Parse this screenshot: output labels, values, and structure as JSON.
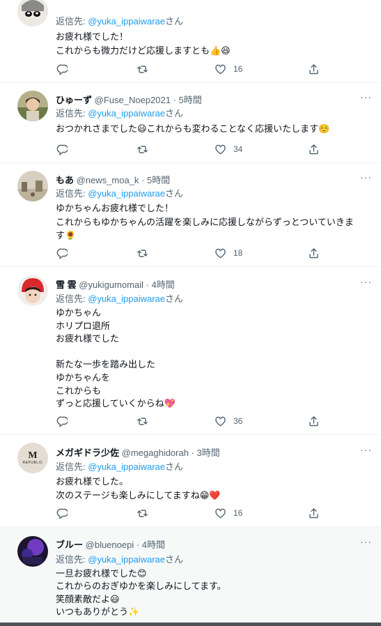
{
  "tweets": [
    {
      "name": "",
      "handle": "",
      "time": "",
      "reply_label": "返信先:",
      "reply_to": "@yuka_ippaiwarae",
      "reply_suffix": "さん",
      "text": "お疲れ様でした！\nこれからも微力だけど応援しますとも👍😆",
      "likes": "16",
      "avatar": "avatar-anime-icon",
      "highlighted": false
    },
    {
      "name": "ひゅーず",
      "handle": "@Fuse_Noep2021",
      "time": "· 5時間",
      "reply_label": "返信先:",
      "reply_to": "@yuka_ippaiwarae",
      "reply_suffix": "さん",
      "text": "おつかれさまでした😃これからも変わることなく応援いたします☺️",
      "likes": "34",
      "avatar": "avatar-photo-icon",
      "highlighted": false
    },
    {
      "name": "もあ",
      "handle": "@news_moa_k",
      "time": "· 5時間",
      "reply_label": "返信先:",
      "reply_to": "@yuka_ippaiwarae",
      "reply_suffix": "さん",
      "text": "ゆかちゃんお疲れ様でした！\nこれからもゆかちゃんの活躍を楽しみに応援しながらずっとついていきま\nす🌻",
      "likes": "18",
      "avatar": "avatar-landscape-icon",
      "highlighted": false
    },
    {
      "name": "雪 雲",
      "handle": "@yukigumomail",
      "time": "· 4時間",
      "reply_label": "返信先:",
      "reply_to": "@yuka_ippaiwarae",
      "reply_suffix": "さん",
      "text": "ゆかちゃん\nホリプロ退所\nお疲れ様でした\n\n新たな一歩を踏み出した\nゆかちゃんを\nこれからも\nずっと応援していくからね💖",
      "likes": "36",
      "avatar": "avatar-red-hat-icon",
      "highlighted": false
    },
    {
      "name": "メガギドラ少佐",
      "handle": "@megaghidorah",
      "time": "· 3時間",
      "reply_label": "返信先:",
      "reply_to": "@yuka_ippaiwarae",
      "reply_suffix": "さん",
      "text": "お疲れ様でした。\n次のステージも楽しみにしてますね😁❤️",
      "likes": "16",
      "avatar": "avatar-republic-logo-icon",
      "highlighted": false
    },
    {
      "name": "ブルー",
      "handle": "@bluenoepi",
      "time": "· 4時間",
      "reply_label": "返信先:",
      "reply_to": "@yuka_ippaiwarae",
      "reply_suffix": "さん",
      "text": "一旦お疲れ様でした😊\nこれからのおぎゆかを楽しみにしてます。\n笑顔素敵だよ😃\nいつもありがとう✨",
      "likes": "",
      "avatar": "avatar-purple-icon",
      "highlighted": true
    }
  ],
  "avatar_texts": {
    "republic_m": "M",
    "republic_word": "REPUBLIC"
  },
  "more_label": "···"
}
